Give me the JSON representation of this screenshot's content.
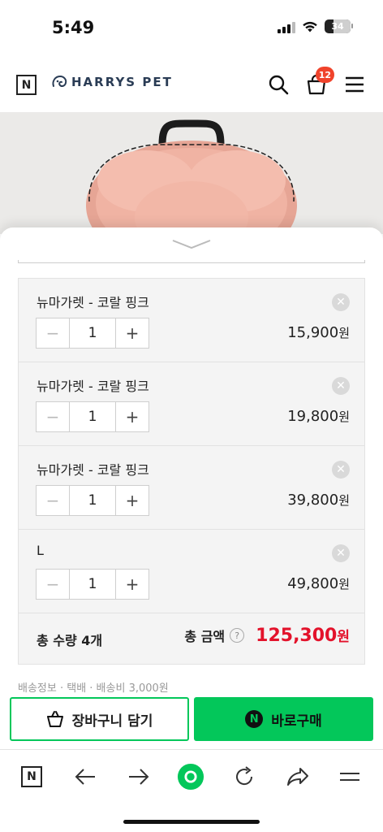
{
  "status_bar": {
    "time": "5:49",
    "battery_level": "34"
  },
  "header": {
    "n_logo": "N",
    "brand": "HARRYS PET",
    "cart_count": "12"
  },
  "items": [
    {
      "name": "뉴마가렛 - 코랄 핑크",
      "qty": "1",
      "price": "15,900",
      "currency": "원"
    },
    {
      "name": "뉴마가렛 - 코랄 핑크",
      "qty": "1",
      "price": "19,800",
      "currency": "원"
    },
    {
      "name": "뉴마가렛 - 코랄 핑크",
      "qty": "1",
      "price": "39,800",
      "currency": "원"
    },
    {
      "name": "L",
      "qty": "1",
      "price": "49,800",
      "currency": "원"
    }
  ],
  "stepper": {
    "minus": "−",
    "plus": "+",
    "remove": "✕"
  },
  "total": {
    "qty_label": "총 수량 4개",
    "amount_label": "총 금액",
    "help": "?",
    "amount": "125,300",
    "currency": "원"
  },
  "shipping_peek": "배송정보 · 택배 · 배송비 3,000원",
  "buttons": {
    "cart": "장바구니 담기",
    "buy": "바로구매",
    "npay_icon": "N"
  },
  "toolbar": {
    "n_logo": "N"
  },
  "colors": {
    "accent_green": "#03c75a",
    "price_red": "#e3122b",
    "badge_red": "#f0432b"
  }
}
